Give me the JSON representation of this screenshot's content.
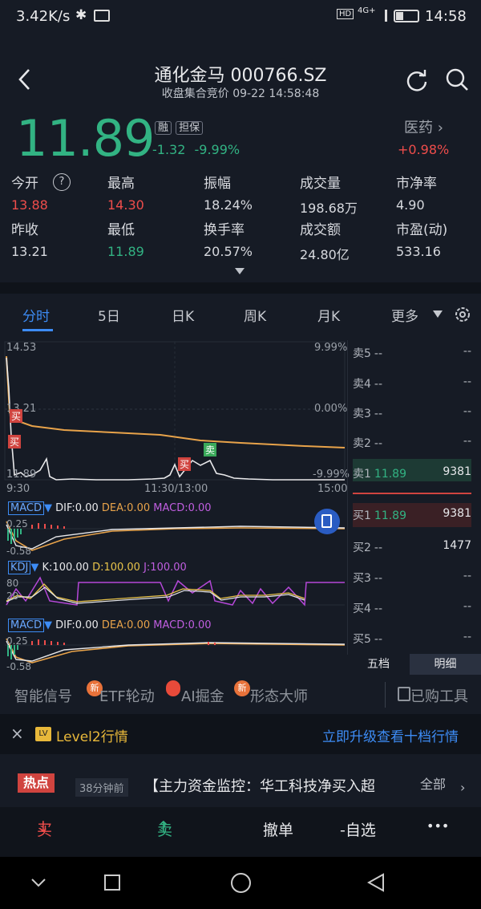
{
  "status_bar": {
    "speed": "3.42K/s",
    "network": "4G+",
    "time": "14:58"
  },
  "header": {
    "title": "通化金马 000766.SZ",
    "subtitle": "收盘集合竞价 09-22 14:58:48"
  },
  "quote": {
    "price": "11.89",
    "tag1": "融",
    "tag2": "担保",
    "change": "-1.32",
    "change_pct": "-9.99%",
    "sector": "医药",
    "sector_pct": "+0.98%"
  },
  "stats": [
    {
      "label": "今开",
      "value": "13.88",
      "color": "#ef4d4b"
    },
    {
      "label": "最高",
      "value": "14.30",
      "color": "#ef4d4b"
    },
    {
      "label": "振幅",
      "value": "18.24%",
      "color": "#d7d9de"
    },
    {
      "label": "成交量",
      "value": "198.68万",
      "color": "#d7d9de"
    },
    {
      "label": "市净率",
      "value": "4.90",
      "color": "#d7d9de"
    },
    {
      "label": "昨收",
      "value": "13.21",
      "color": "#d7d9de"
    },
    {
      "label": "最低",
      "value": "11.89",
      "color": "#32b383"
    },
    {
      "label": "换手率",
      "value": "20.57%",
      "color": "#d7d9de"
    },
    {
      "label": "成交额",
      "value": "24.80亿",
      "color": "#d7d9de"
    },
    {
      "label": "市盈(动)",
      "value": "533.16",
      "color": "#d7d9de"
    }
  ],
  "tabs": [
    "分时",
    "5日",
    "日K",
    "周K",
    "月K",
    "更多"
  ],
  "chart": {
    "y_top": "14.53",
    "y_mid": "13.21",
    "y_bot": "11.89",
    "pct_top": "9.99%",
    "pct_mid": "0.00%",
    "pct_bot": "-9.99%",
    "t_start": "9:30",
    "t_mid": "11:30/13:00",
    "t_end": "15:00",
    "buy_mark": "买",
    "sell_mark": "卖",
    "macd1": {
      "name": "MACD",
      "dif": "DIF:0.00",
      "dea": "DEA:0.00",
      "macd": "MACD:0.00",
      "top": "0.25",
      "bot": "-0.58"
    },
    "kdj": {
      "name": "KDJ",
      "k": "K:100.00",
      "d": "D:100.00",
      "j": "J:100.00",
      "top": "80",
      "bot": "20"
    },
    "macd2": {
      "name": "MACD",
      "dif": "DIF:0.00",
      "dea": "DEA:0.00",
      "macd": "MACD:0.00",
      "top": "0.25",
      "bot": "-0.58"
    }
  },
  "orderbook": {
    "sells": [
      {
        "label": "卖5",
        "price": "--",
        "vol": "--"
      },
      {
        "label": "卖4",
        "price": "--",
        "vol": "--"
      },
      {
        "label": "卖3",
        "price": "--",
        "vol": "--"
      },
      {
        "label": "卖2",
        "price": "--",
        "vol": "--"
      },
      {
        "label": "卖1",
        "price": "11.89",
        "vol": "9381"
      }
    ],
    "buys": [
      {
        "label": "买1",
        "price": "11.89",
        "vol": "9381"
      },
      {
        "label": "买2",
        "price": "--",
        "vol": "1477"
      },
      {
        "label": "买3",
        "price": "--",
        "vol": "--"
      },
      {
        "label": "买4",
        "price": "--",
        "vol": "--"
      },
      {
        "label": "买5",
        "price": "--",
        "vol": "--"
      }
    ],
    "tab_five": "五档",
    "tab_detail": "明细"
  },
  "tools": {
    "t1": "智能信号",
    "t2": "ETF轮动",
    "t3": "AI掘金",
    "t4": "形态大师",
    "t5": "已购工具",
    "badge": "新"
  },
  "level2": {
    "label": "Level2行情",
    "cta": "立即升级查看十档行情"
  },
  "news": {
    "tag": "热点",
    "time": "38分钟前",
    "text": "【主力资金监控：华工科技净买入超",
    "all": "全部"
  },
  "actions": {
    "buy": "买",
    "sell": "卖",
    "cancel": "撤单",
    "watch": "-自选",
    "more": "•••"
  }
}
